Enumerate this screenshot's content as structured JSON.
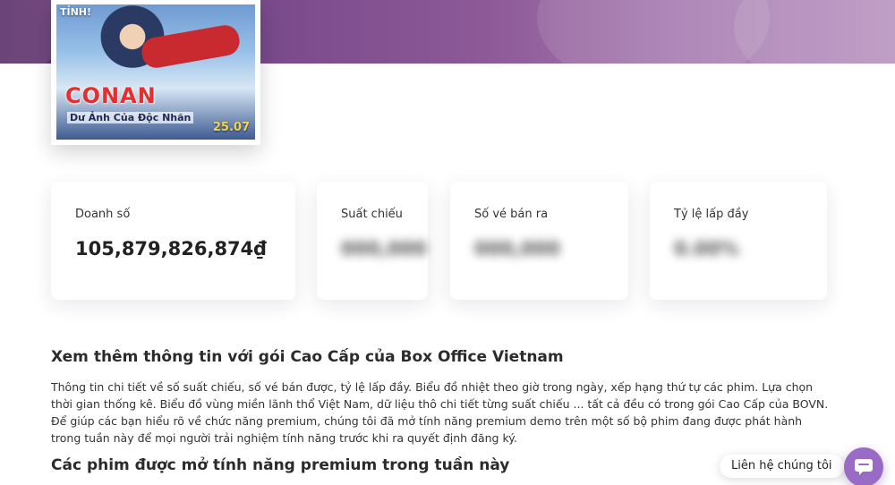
{
  "hero": {
    "accent": "#7a4a8a"
  },
  "poster": {
    "tag": "TỈNH!",
    "logo": "CONAN",
    "subtitle": "Dư Ảnh Của Độc Nhãn",
    "date": "25.07"
  },
  "stats": [
    {
      "label": "Doanh số",
      "value": "105,879,826,874₫",
      "hidden": false
    },
    {
      "label": "Suất chiếu",
      "value": "000,000",
      "hidden": true
    },
    {
      "label": "Số vé bán ra",
      "value": "000,000",
      "hidden": true
    },
    {
      "label": "Tỷ lệ lấp đầy",
      "value": "0.00%",
      "hidden": true
    }
  ],
  "premium": {
    "title": "Xem thêm thông tin với gói Cao Cấp của Box Office Vietnam",
    "paragraph1": "Thông tin chi tiết về số suất chiếu, số vé bán được, tỷ lệ lấp đầy. Biểu đồ nhiệt theo giờ trong ngày, xếp hạng thứ tự các phim. Lựa chọn thời gian thống kê. Biểu đồ vùng miền lãnh thổ Việt Nam, dữ liệu thô chi tiết từng suất chiếu ... tất cả đều có trong gói Cao Cấp của BOVN.",
    "paragraph2": "Để giúp các bạn hiểu rõ về chức năng premium, chúng tôi đã mở tính năng premium demo trên một số bộ phim đang được phát hành trong tuần này để mọi người trải nghiệm tính năng trước khi ra quyết định đăng ký."
  },
  "week_section": {
    "title": "Các phim được mở tính năng premium trong tuần này"
  },
  "contact": {
    "label": "Liên hệ chúng tôi",
    "icon": "chat-icon",
    "color": "#9a6bc4"
  }
}
